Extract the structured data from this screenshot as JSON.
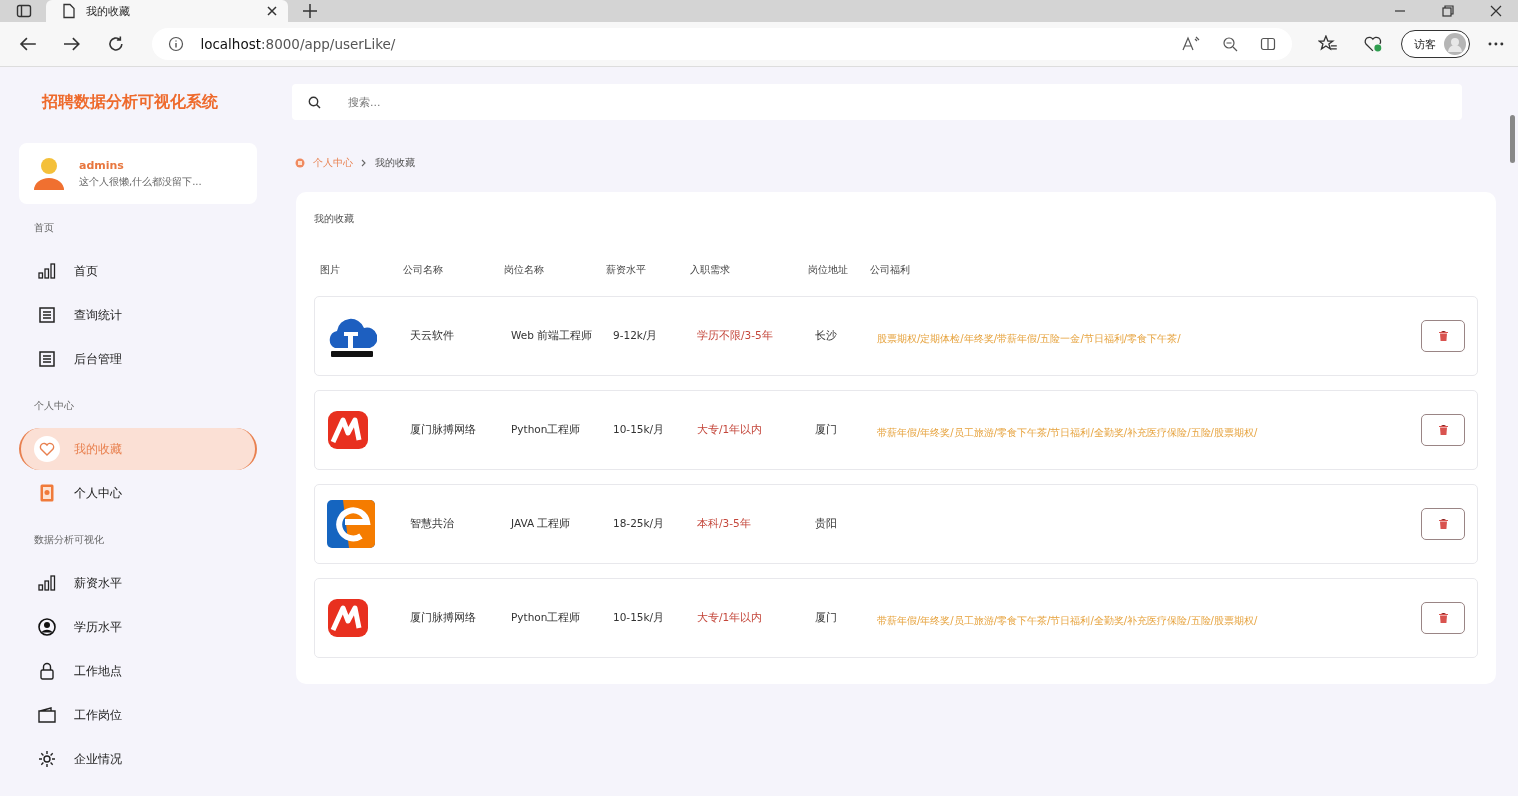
{
  "browser": {
    "tab_title": "我的收藏",
    "url_host": "localhost",
    "url_path": ":8000/app/userLike/",
    "profile": "访客"
  },
  "app": {
    "title": "招聘数据分析可视化系统",
    "search": {
      "placeholder": "搜索..."
    }
  },
  "user": {
    "name": "admins",
    "bio": "这个人很懒,什么都没留下..."
  },
  "sidebar": {
    "sections": [
      {
        "heading": "首页",
        "items": [
          {
            "label": "首页",
            "selected": false
          },
          {
            "label": "查询统计",
            "selected": false
          },
          {
            "label": "后台管理",
            "selected": false
          }
        ]
      },
      {
        "heading": "个人中心",
        "items": [
          {
            "label": "我的收藏",
            "selected": true
          },
          {
            "label": "个人中心",
            "selected": false
          }
        ]
      },
      {
        "heading": "数据分析可视化",
        "items": [
          {
            "label": "薪资水平",
            "selected": false
          },
          {
            "label": "学历水平",
            "selected": false
          },
          {
            "label": "工作地点",
            "selected": false
          },
          {
            "label": "工作岗位",
            "selected": false
          },
          {
            "label": "企业情况",
            "selected": false
          }
        ]
      }
    ]
  },
  "breadcrumb": [
    "个人中心",
    "我的收藏"
  ],
  "table": {
    "title": "我的收藏",
    "columns": [
      "图片",
      "公司名称",
      "岗位名称",
      "薪资水平",
      "入职需求",
      "岗位地址",
      "公司福利"
    ],
    "rows": [
      {
        "kind": "cloud",
        "company": "天云软件",
        "position": "Web 前端工程师",
        "salary": "9-12k/月",
        "requirement": "学历不限/3-5年",
        "location": "长沙",
        "welfare": "股票期权/定期体检/年终奖/带薪年假/五险一金/节日福利/零食下午茶/"
      },
      {
        "kind": "m",
        "company": "厦门脉搏网络",
        "position": "Python工程师",
        "salary": "10-15k/月",
        "requirement": "大专/1年以内",
        "location": "厦门",
        "welfare": "带薪年假/年终奖/员工旅游/零食下午茶/节日福利/全勤奖/补充医疗保险/五险/股票期权/"
      },
      {
        "kind": "e",
        "company": "智慧共治",
        "position": "JAVA 工程师",
        "salary": "18-25k/月",
        "requirement": "本科/3-5年",
        "location": "贵阳"
      },
      {
        "kind": "m",
        "company": "厦门脉搏网络",
        "position": "Python工程师",
        "salary": "10-15k/月",
        "requirement": "大专/1年以内",
        "location": "厦门",
        "welfare": "带薪年假/年终奖/员工旅游/零食下午茶/节日福利/全勤奖/补充医疗保险/五险/股票期权/"
      }
    ]
  }
}
